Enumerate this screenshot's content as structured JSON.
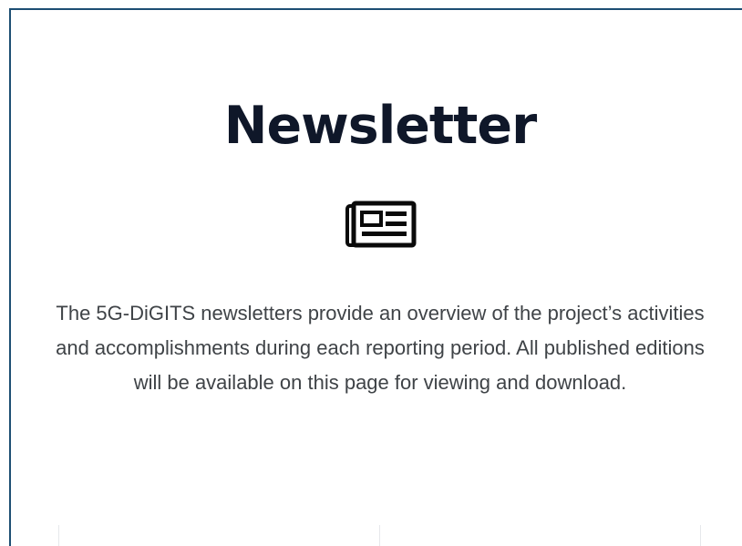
{
  "page": {
    "title": "Newsletter",
    "icon": "newspaper-icon",
    "description": "The 5G-DiGITS newsletters provide an overview of the project’s activities and accomplishments during each reporting period. All published editions will be available on this page for viewing and download."
  },
  "colors": {
    "title": "#0f1729",
    "body_text": "#3f4347",
    "frame_border": "#1d4e73",
    "divider": "#e6e8eb"
  }
}
